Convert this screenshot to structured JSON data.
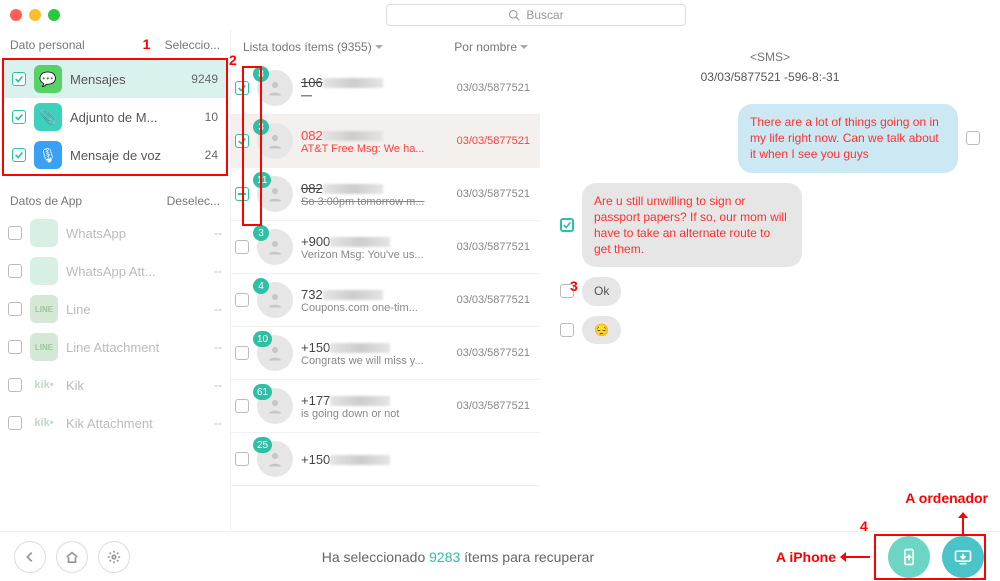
{
  "search": {
    "placeholder": "Buscar"
  },
  "annotations": {
    "n1": "1",
    "n2": "2",
    "n3": "3",
    "n4": "4",
    "a_iphone": "A iPhone",
    "a_ordenador": "A ordenador"
  },
  "sidebar": {
    "section1": {
      "title": "Dato personal",
      "action": "Seleccio..."
    },
    "personal": [
      {
        "label": "Mensajes",
        "count": "9249",
        "checked": true,
        "selected": true,
        "iconClass": "ic-green",
        "glyph": "💬"
      },
      {
        "label": "Adjunto de M...",
        "count": "10",
        "checked": true,
        "selected": false,
        "iconClass": "ic-teal",
        "glyph": "📎"
      },
      {
        "label": "Mensaje de voz",
        "count": "24",
        "checked": true,
        "selected": false,
        "iconClass": "ic-blue",
        "glyph": "🎙"
      }
    ],
    "section2": {
      "title": "Datos de App",
      "action": "Deselec..."
    },
    "app": [
      {
        "label": "WhatsApp",
        "count": "--",
        "iconClass": "ic-dim"
      },
      {
        "label": "WhatsApp Att...",
        "count": "--",
        "iconClass": "ic-dim"
      },
      {
        "label": "Line",
        "count": "--",
        "iconClass": "ic-line"
      },
      {
        "label": "Line Attachment",
        "count": "--",
        "iconClass": "ic-line"
      },
      {
        "label": "Kik",
        "count": "--",
        "iconClass": "ic-kik"
      },
      {
        "label": "Kik Attachment",
        "count": "--",
        "iconClass": "ic-kik"
      }
    ]
  },
  "threads": {
    "header": {
      "left": "Lista todos ítems (9355)",
      "right": "Por nombre"
    },
    "items": [
      {
        "badge": "8",
        "title": "106",
        "preview": "—",
        "date": "03/03/5877521",
        "checked": "on",
        "strike": true
      },
      {
        "badge": "3",
        "title": "082",
        "preview": "AT&T Free Msg: We ha...",
        "date": "03/03/5877521",
        "checked": "on",
        "red": true,
        "selected": true
      },
      {
        "badge": "11",
        "title": "082",
        "preview": "So 3:00pm tomorrow m...",
        "date": "03/03/5877521",
        "checked": "half",
        "strike": true
      },
      {
        "badge": "3",
        "title": "+900",
        "preview": "Verizon Msg: You've us...",
        "date": "03/03/5877521",
        "checked": "off"
      },
      {
        "badge": "4",
        "title": "732",
        "preview": "Coupons.com one-tim...",
        "date": "03/03/5877521",
        "checked": "off"
      },
      {
        "badge": "10",
        "title": "+150",
        "preview": "Congrats we will miss y...",
        "date": "03/03/5877521",
        "checked": "off"
      },
      {
        "badge": "61",
        "title": "+177",
        "preview": "is going down or not",
        "date": "03/03/5877521",
        "checked": "off"
      },
      {
        "badge": "25",
        "title": "+150",
        "preview": "",
        "date": "",
        "checked": "off"
      }
    ]
  },
  "detail": {
    "header": "<SMS>",
    "sub": "03/03/5877521 -596-8:-31",
    "msgs": [
      {
        "dir": "out",
        "text": "There are a lot of things going on in my life right now. Can we talk about it when I see you guys",
        "red": true,
        "chk": false
      },
      {
        "dir": "in",
        "text": "Are u still unwilling to sign or passport papers? If so, our mom will have to take an alternate route to get them.",
        "red": true,
        "chk": true,
        "boxed": true
      },
      {
        "dir": "in",
        "text": "Ok",
        "red": false,
        "chk": false
      },
      {
        "dir": "in",
        "text": "😔",
        "red": false,
        "chk": false
      }
    ]
  },
  "footer": {
    "text_a": "Ha seleccionado ",
    "count": "9283",
    "text_b": " ítems para recuperar"
  }
}
